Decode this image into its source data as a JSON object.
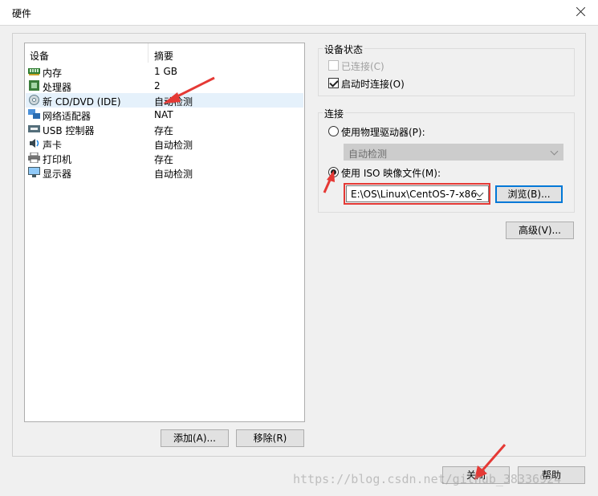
{
  "window": {
    "title": "硬件"
  },
  "device_list": {
    "columns": [
      "设备",
      "摘要"
    ],
    "rows": [
      {
        "icon": "memory-icon",
        "name": "内存",
        "summary": "1 GB"
      },
      {
        "icon": "processor-icon",
        "name": "处理器",
        "summary": "2"
      },
      {
        "icon": "cd-dvd-icon",
        "name": "新 CD/DVD (IDE)",
        "summary": "自动检测",
        "selected": true
      },
      {
        "icon": "network-adapter-icon",
        "name": "网络适配器",
        "summary": "NAT"
      },
      {
        "icon": "usb-icon",
        "name": "USB 控制器",
        "summary": "存在"
      },
      {
        "icon": "sound-card-icon",
        "name": "声卡",
        "summary": "自动检测"
      },
      {
        "icon": "printer-icon",
        "name": "打印机",
        "summary": "存在"
      },
      {
        "icon": "display-icon",
        "name": "显示器",
        "summary": "自动检测"
      }
    ]
  },
  "buttons": {
    "add": "添加(A)...",
    "remove": "移除(R)",
    "browse": "浏览(B)...",
    "advanced": "高级(V)...",
    "close": "关闭",
    "help": "帮助"
  },
  "device_status": {
    "label": "设备状态",
    "connected": {
      "label": "已连接(C)",
      "checked": false,
      "enabled": false
    },
    "connect_at_power_on": {
      "label": "启动时连接(O)",
      "checked": true,
      "enabled": true
    }
  },
  "connection": {
    "label": "连接",
    "physical_drive": {
      "label": "使用物理驱动器(P):",
      "selected": false
    },
    "physical_drive_value": "自动检测",
    "iso_image": {
      "label": "使用 ISO 映像文件(M):",
      "selected": true
    },
    "iso_path": "E:\\OS\\Linux\\CentOS-7-x86_"
  },
  "annotations": {
    "accent": "#e53935",
    "highlight": "#e53935"
  },
  "watermark": "https://blog.csdn.net/github_38336924"
}
